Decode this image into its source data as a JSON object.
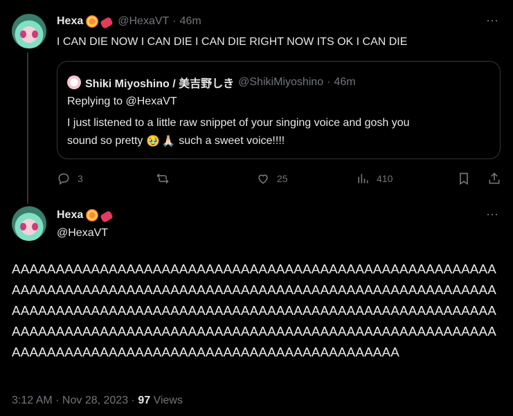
{
  "tweet": {
    "author_name": "Hexa",
    "handle": "@HexaVT",
    "separator": "·",
    "time": "46m",
    "text": "I CAN DIE NOW I CAN DIE I CAN DIE RIGHT NOW ITS OK I CAN DIE",
    "quote": {
      "author_name": "Shiki Miyoshino / 美吉野しき",
      "handle": "@ShikiMiyoshino",
      "separator": "·",
      "time": "46m",
      "replying_to": "Replying to @HexaVT",
      "text_line1": "I just listened to a little raw snippet of your singing voice and gosh you",
      "text_line2_prefix": "sound so pretty",
      "emoji_1": "🥹",
      "emoji_2": "🙏🏻",
      "text_line2_suffix": "such a sweet voice!!!!"
    },
    "actions": {
      "replies": "3",
      "likes": "25",
      "views": "410"
    }
  },
  "reply": {
    "author_name": "Hexa",
    "handle": "@HexaVT",
    "text": "AAAAAAAAAAAAAAAAAAAAAAAAAAAAAAAAAAAAAAAAAAAAAAAAAAAAAAAAAAAAAAAAAAAAAAAAAAAAAAAAAAAAAAAAAAAAAAAAAAAAAAAAAAAAAAAAAAAAAAAAAAAAAAAAAAAAAAAAAAAAAAAAAAAAAAAAAAAAAAAAAAAAAAAAAAAAAAAAAAAAAAAAAAAAAAAAAAAAAAAAAAAAAAAAAAAAAAAAAAAAAAAAAAAAAAAAAAAAAAAAAAAAAAAAAAAAAAAAAAAAAAAA",
    "timestamp": "3:12 AM · Nov 28, 2023 · ",
    "views_count": "97",
    "views_label": " Views"
  },
  "icons": {
    "more": "⋯"
  }
}
